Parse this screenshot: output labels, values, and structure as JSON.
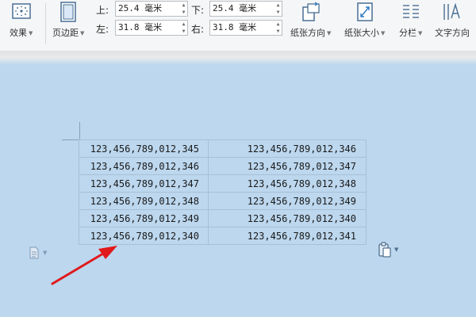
{
  "toolbar": {
    "effects_label": "效果",
    "margins_label": "页边距",
    "orientation_label": "纸张方向",
    "paper_size_label": "纸张大小",
    "columns_label": "分栏",
    "text_direction_label": "文字方向"
  },
  "margins": {
    "top": {
      "label": "上:",
      "value": "25.4 毫米"
    },
    "bottom": {
      "label": "下:",
      "value": "25.4 毫米"
    },
    "left": {
      "label": "左:",
      "value": "31.8 毫米"
    },
    "right": {
      "label": "右:",
      "value": "31.8 毫米"
    }
  },
  "table": {
    "rows": [
      [
        "123,456,789,012,345",
        "123,456,789,012,346"
      ],
      [
        "123,456,789,012,346",
        "123,456,789,012,347"
      ],
      [
        "123,456,789,012,347",
        "123,456,789,012,348"
      ],
      [
        "123,456,789,012,348",
        "123,456,789,012,349"
      ],
      [
        "123,456,789,012,349",
        "123,456,789,012,340"
      ],
      [
        "123,456,789,012,340",
        "123,456,789,012,341"
      ]
    ]
  },
  "icons": {
    "effects": "effects-icon",
    "margins": "page-margins-icon",
    "orientation": "page-orientation-icon",
    "paper_size": "paper-size-icon",
    "columns": "columns-icon",
    "text_direction": "text-direction-icon",
    "paste_options": "paste-options-icon",
    "clipboard": "clipboard-icon"
  },
  "colors": {
    "background": "#bcd7ee",
    "ribbon": "#f5f6f7",
    "arrow": "#e0191b",
    "table_border": "#a9c0d6"
  }
}
